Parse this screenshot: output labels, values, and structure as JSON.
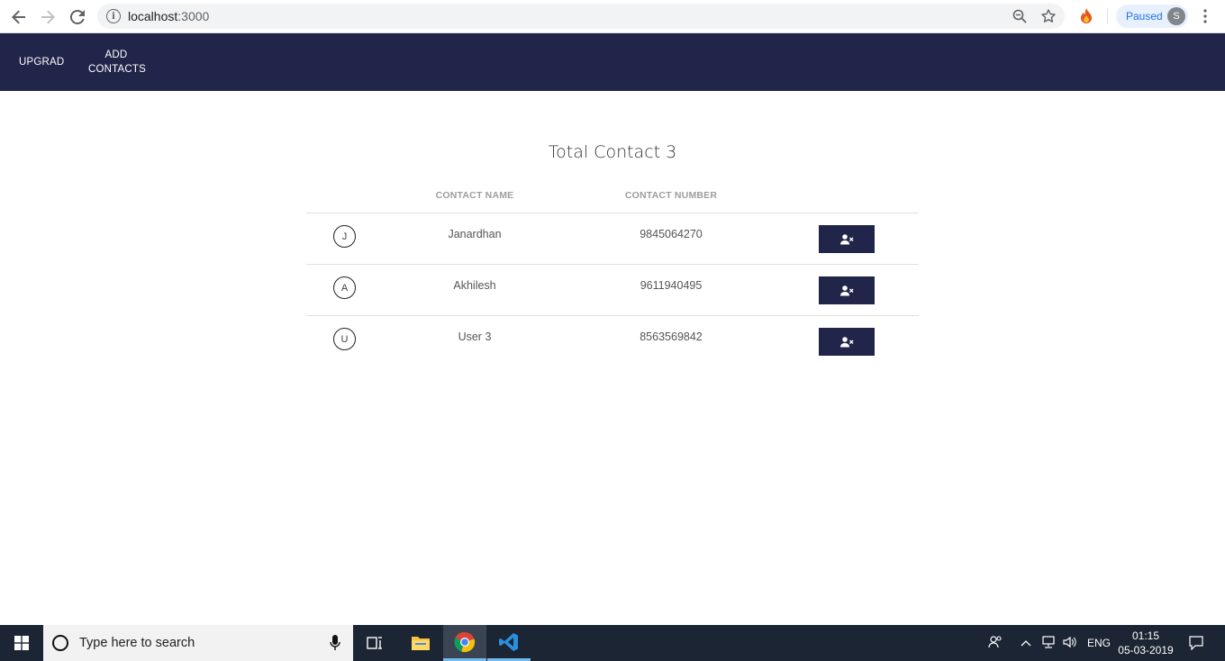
{
  "browser": {
    "url_host": "localhost",
    "url_port": ":3000",
    "profile_status": "Paused",
    "profile_initial": "S"
  },
  "navbar": {
    "brand": "UPGRAD",
    "add_contacts": "ADD\nCONTACTS"
  },
  "main": {
    "title": "Total Contact 3",
    "columns": {
      "name": "CONTACT NAME",
      "number": "CONTACT NUMBER"
    },
    "contacts": [
      {
        "initial": "J",
        "name": "Janardhan",
        "number": "9845064270"
      },
      {
        "initial": "A",
        "name": "Akhilesh",
        "number": "9611940495"
      },
      {
        "initial": "U",
        "name": "User 3",
        "number": "8563569842"
      }
    ]
  },
  "taskbar": {
    "search_placeholder": "Type here to search",
    "language": "ENG",
    "time": "01:15",
    "date": "05-03-2019"
  },
  "colors": {
    "navbar": "#212549",
    "button": "#212549"
  }
}
